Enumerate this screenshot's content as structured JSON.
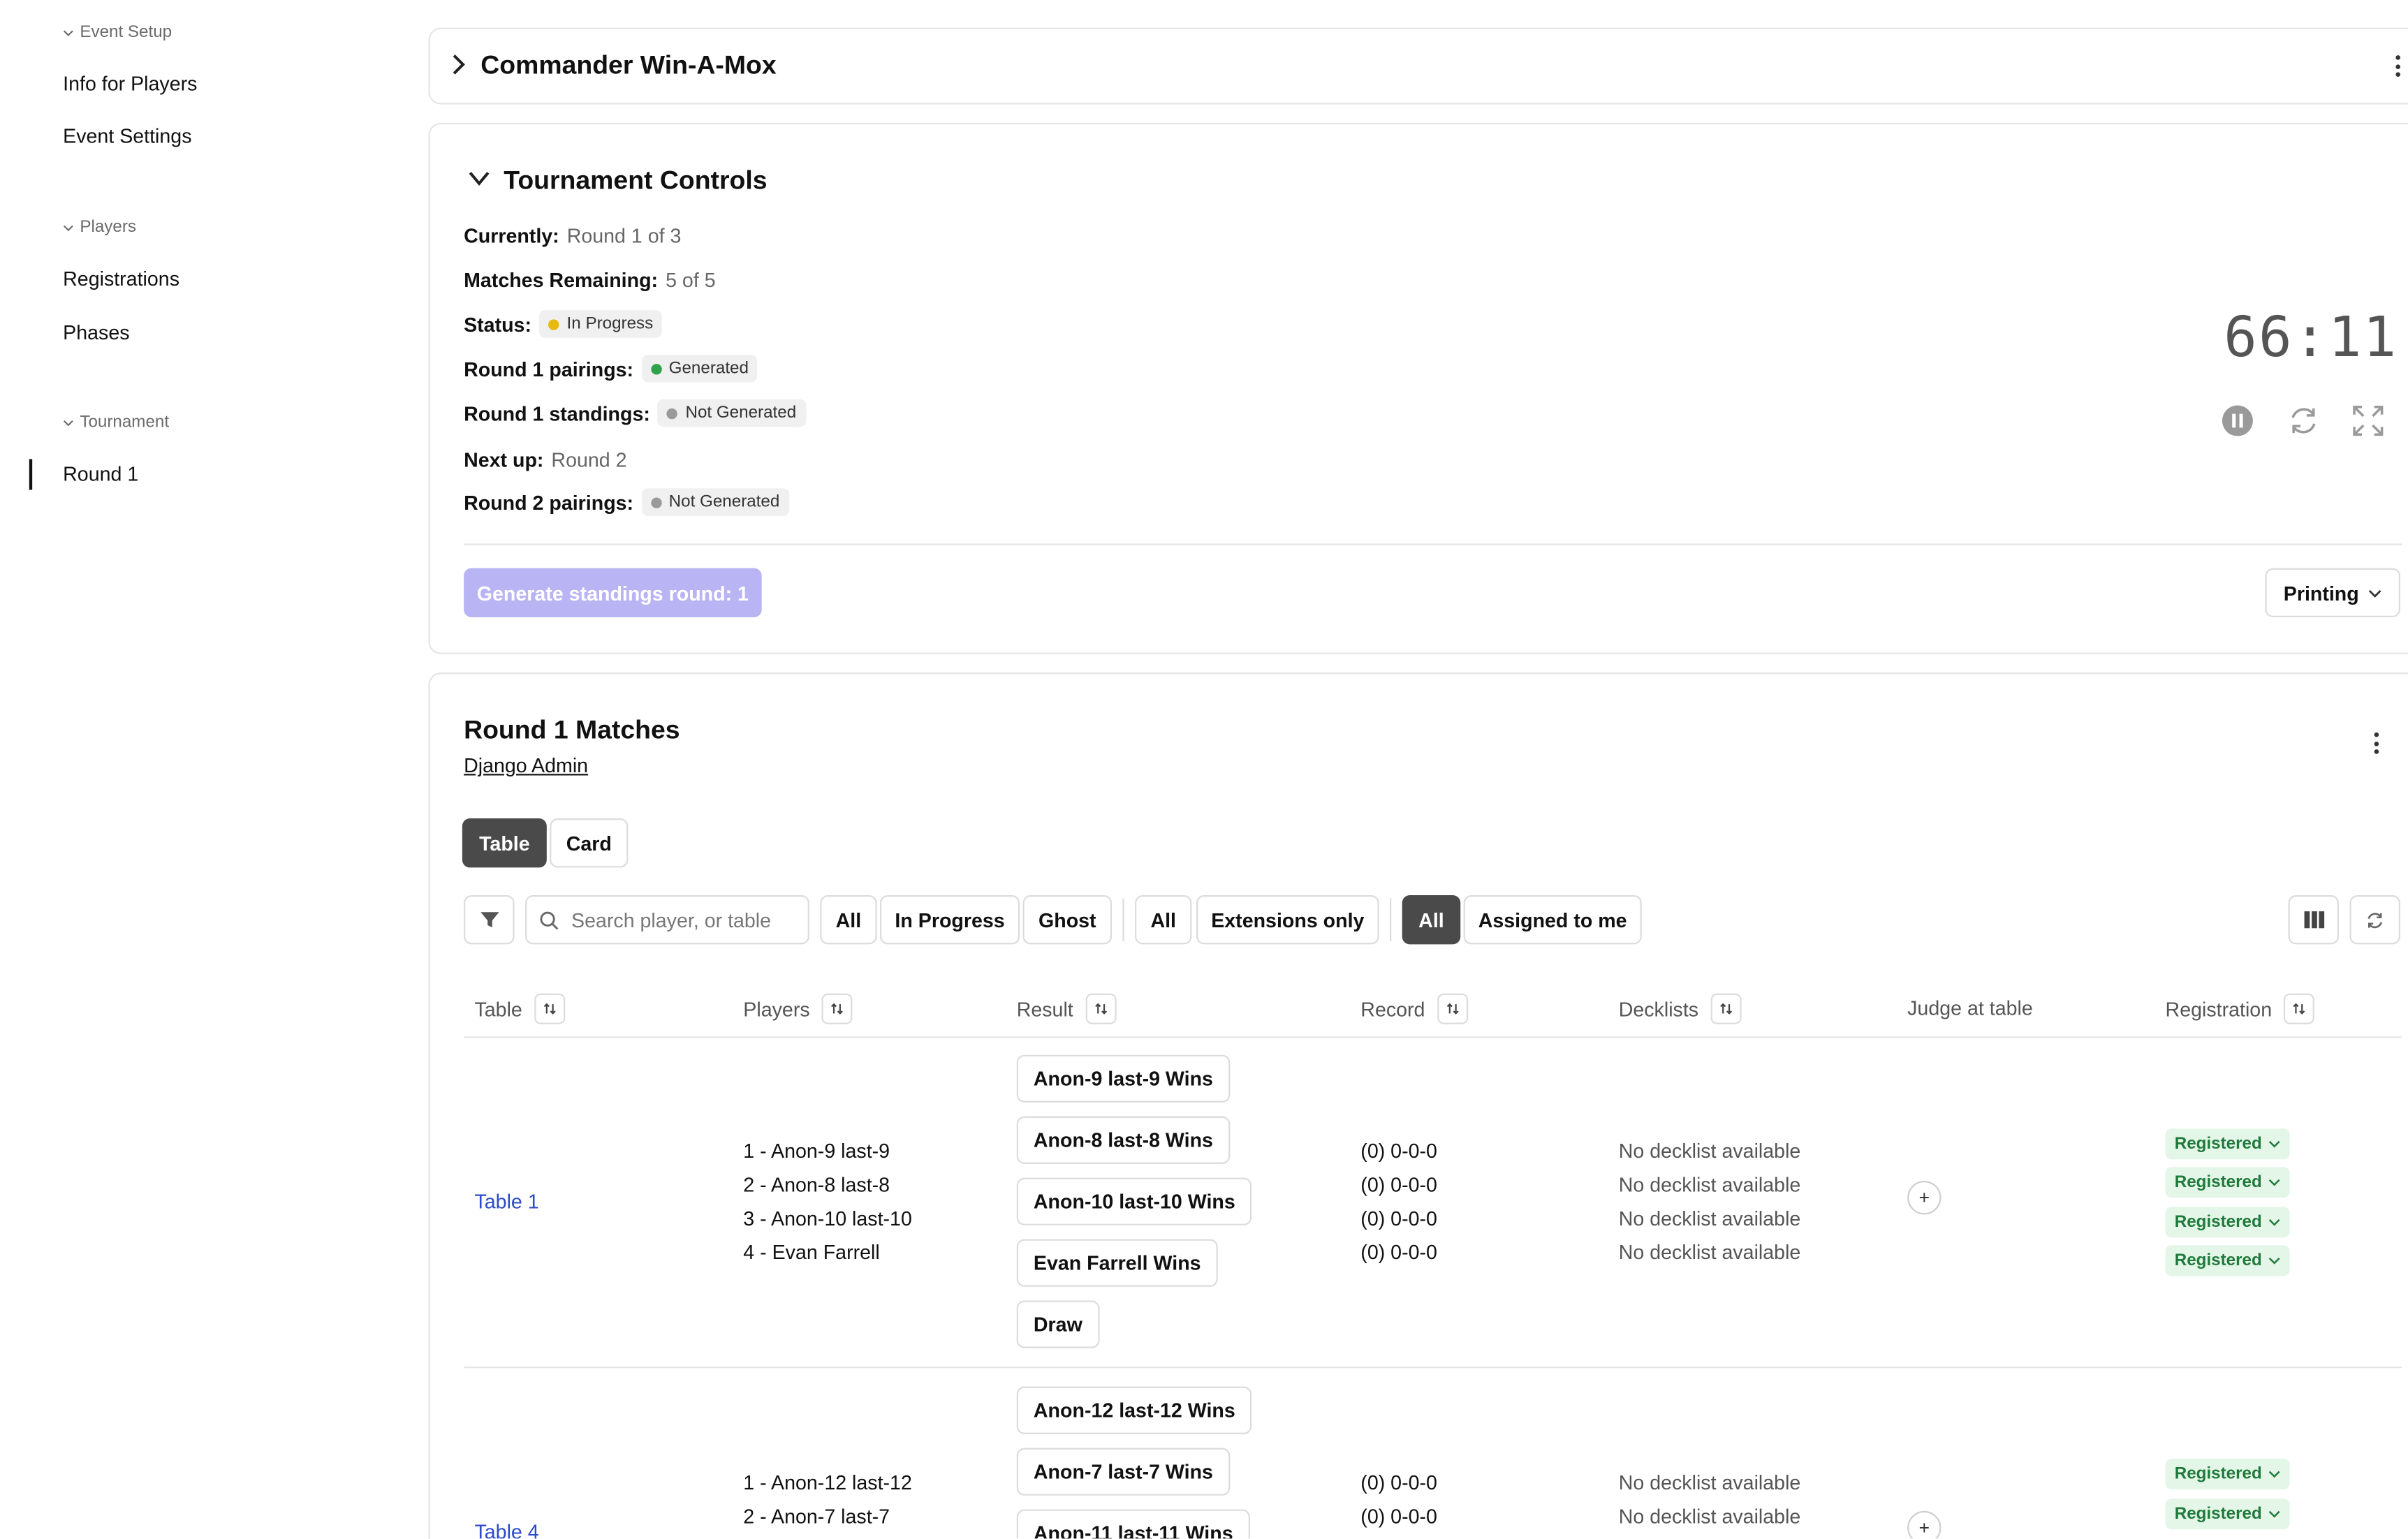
{
  "sidebar": {
    "sections": [
      {
        "label": "Event Setup",
        "items": [
          "Info for Players",
          "Event Settings"
        ]
      },
      {
        "label": "Players",
        "items": [
          "Registrations",
          "Phases"
        ]
      },
      {
        "label": "Tournament",
        "items": [
          "Round 1"
        ]
      }
    ]
  },
  "event": {
    "title": "Commander Win-A-Mox"
  },
  "controls": {
    "title": "Tournament Controls",
    "currently_label": "Currently:",
    "currently_value": "Round 1 of 3",
    "matches_label": "Matches Remaining:",
    "matches_value": "5 of 5",
    "status_label": "Status:",
    "status_value": "In Progress",
    "pairings_label": "Round 1 pairings:",
    "pairings_value": "Generated",
    "standings_label": "Round 1 standings:",
    "standings_value": "Not Generated",
    "next_label": "Next up:",
    "next_value": "Round 2",
    "next_pairings_label": "Round 2 pairings:",
    "next_pairings_value": "Not Generated",
    "timer": "66:11",
    "generate_button": "Generate standings round: 1",
    "printing_button": "Printing"
  },
  "matches": {
    "title": "Round 1 Matches",
    "admin_link": "Django Admin",
    "view_tabs": [
      "Table",
      "Card"
    ],
    "search_placeholder": "Search player, or table",
    "filters_status": [
      "All",
      "In Progress",
      "Ghost"
    ],
    "filters_ext": [
      "All",
      "Extensions only"
    ],
    "filters_assign": [
      "All",
      "Assigned to me"
    ],
    "columns": [
      "Table",
      "Players",
      "Result",
      "Record",
      "Decklists",
      "Judge at table",
      "Registration"
    ],
    "rows": [
      {
        "table": "Table 1",
        "players": [
          "1 - Anon-9 last-9",
          "2 - Anon-8 last-8",
          "3 - Anon-10 last-10",
          "4 - Evan Farrell"
        ],
        "results": [
          "Anon-9 last-9 Wins",
          "Anon-8 last-8 Wins",
          "Anon-10 last-10 Wins",
          "Evan Farrell Wins",
          "Draw"
        ],
        "records": [
          "(0) 0-0-0",
          "(0) 0-0-0",
          "(0) 0-0-0",
          "(0) 0-0-0"
        ],
        "decklists": [
          "No decklist available",
          "No decklist available",
          "No decklist available",
          "No decklist available"
        ],
        "judge": "+",
        "registration": [
          "Registered",
          "Registered",
          "Registered",
          "Registered"
        ]
      },
      {
        "table": "Table 4",
        "players": [
          "1 - Anon-12 last-12",
          "2 - Anon-7 last-7"
        ],
        "results": [
          "Anon-12 last-12 Wins",
          "Anon-7 last-7 Wins",
          "Anon-11 last-11 Wins"
        ],
        "records": [
          "(0) 0-0-0",
          "(0) 0-0-0"
        ],
        "decklists": [
          "No decklist available",
          "No decklist available"
        ],
        "judge": "+",
        "registration": [
          "Registered",
          "Registered"
        ]
      }
    ]
  },
  "colors": {
    "accent_disabled": "#b9b4f3",
    "status_yellow": "#e8b90f",
    "status_green": "#2fa24a",
    "status_gray": "#9a9a9a",
    "link_blue": "#2b4acb",
    "registered_bg": "#e4f6e8",
    "registered_text": "#1f7a3b"
  }
}
